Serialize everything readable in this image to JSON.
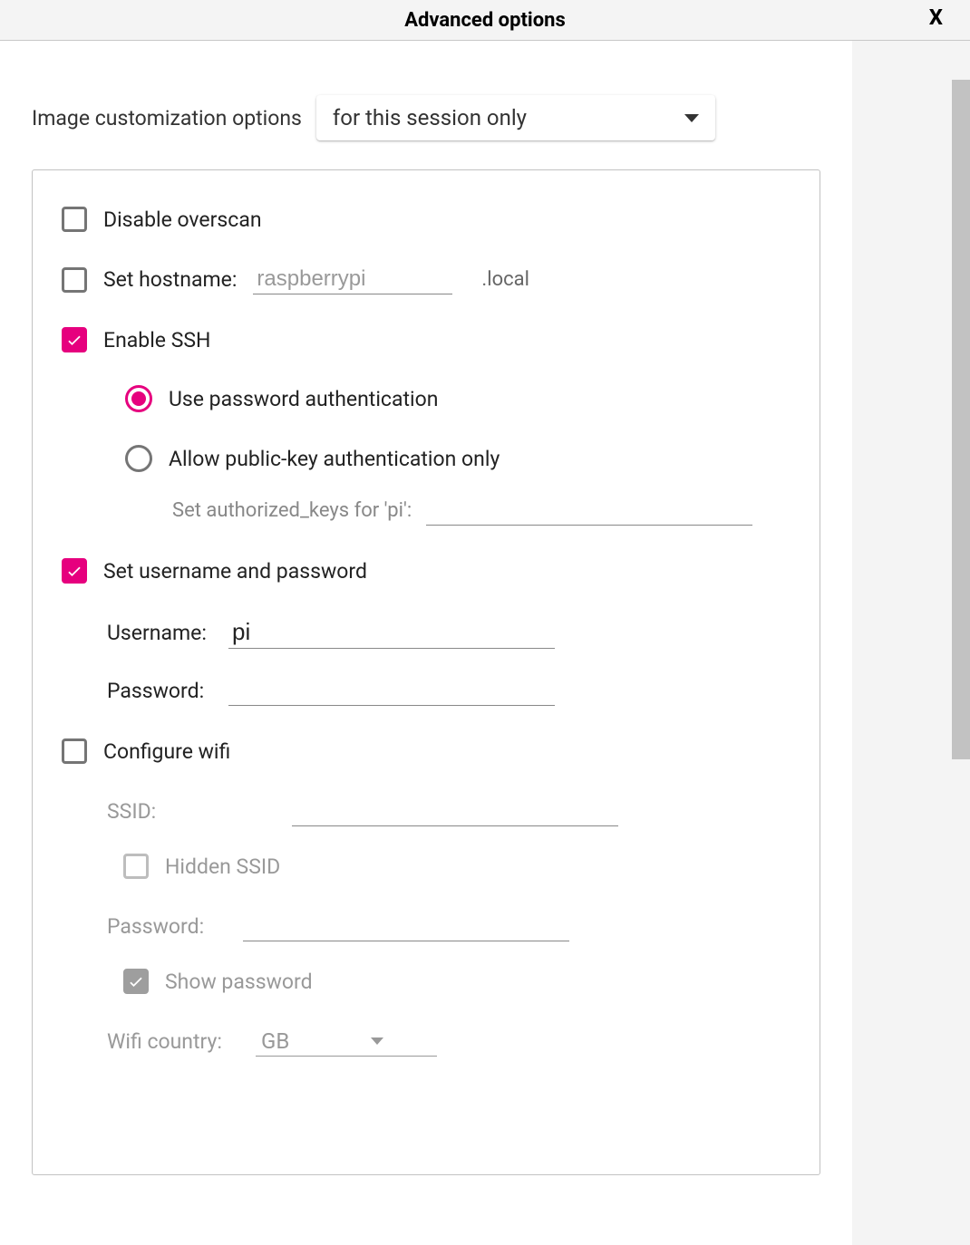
{
  "header": {
    "title": "Advanced options",
    "close": "X"
  },
  "top": {
    "label": "Image customization options",
    "selected": "for this session only"
  },
  "options": {
    "disable_overscan": {
      "label": "Disable overscan"
    },
    "set_hostname": {
      "label": "Set hostname:",
      "value": "raspberrypi",
      "suffix": ".local"
    },
    "enable_ssh": {
      "label": "Enable SSH",
      "radio_password": "Use password authentication",
      "radio_pubkey": "Allow public-key authentication only",
      "authkeys_label": "Set authorized_keys for 'pi':",
      "authkeys_value": ""
    },
    "set_userpass": {
      "label": "Set username and password",
      "username_label": "Username:",
      "username_value": "pi",
      "password_label": "Password:",
      "password_value": ""
    },
    "wifi": {
      "label": "Configure wifi",
      "ssid_label": "SSID:",
      "ssid_value": "",
      "hidden_ssid_label": "Hidden SSID",
      "password_label": "Password:",
      "password_value": "",
      "show_password_label": "Show password",
      "country_label": "Wifi country:",
      "country_value": "GB"
    }
  }
}
